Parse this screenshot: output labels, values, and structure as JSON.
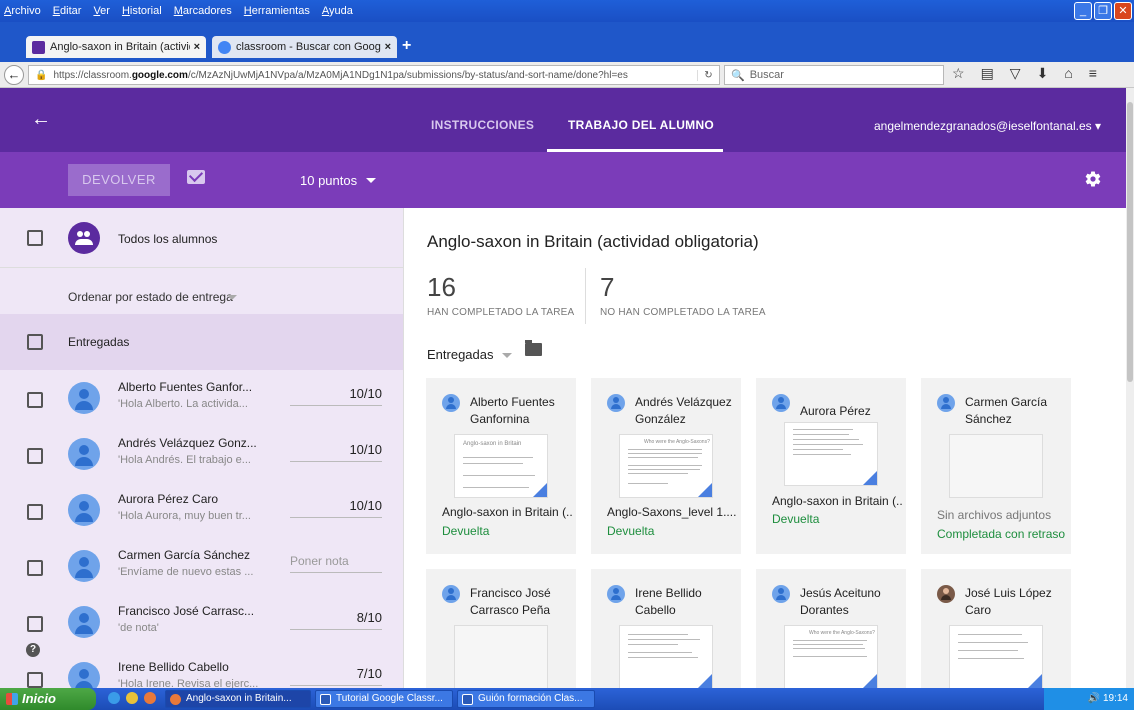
{
  "browser": {
    "menu": [
      "Archivo",
      "Editar",
      "Ver",
      "Historial",
      "Marcadores",
      "Herramientas",
      "Ayuda"
    ],
    "tabs": [
      {
        "title": "Anglo-saxon in Britain (activid...",
        "close": "×",
        "color": "#5b2b9f"
      },
      {
        "title": "classroom - Buscar con Google",
        "close": "×",
        "color": "#4285f4"
      }
    ],
    "new_tab": "+",
    "url_prefix": "https://classroom.",
    "url_domain": "google.com",
    "url_suffix": "/c/MzAzNjUwMjA1NVpa/a/MzA0MjA1NDg1N1pa/submissions/by-status/and-sort-name/done?hl=es",
    "search_placeholder": "Buscar"
  },
  "app_header": {
    "tab_instructions": "INSTRUCCIONES",
    "tab_student_work": "TRABAJO DEL ALUMNO",
    "user_email": "angelmendezgranados@ieselfontanal.es"
  },
  "toolbar": {
    "return_label": "DEVOLVER",
    "points_label": "10 puntos"
  },
  "left_panel": {
    "all_students_label": "Todos los alumnos",
    "sort_label": "Ordenar por estado de entrega",
    "group_label": "Entregadas",
    "students": [
      {
        "name": "Alberto Fuentes Ganfor...",
        "preview": "'Hola Alberto. La activida...",
        "grade": "10/10"
      },
      {
        "name": "Andrés Velázquez Gonz...",
        "preview": "'Hola Andrés. El trabajo e...",
        "grade": "10/10"
      },
      {
        "name": "Aurora Pérez Caro",
        "preview": "'Hola Aurora, muy buen tr...",
        "grade": "10/10"
      },
      {
        "name": "Carmen García Sánchez",
        "preview": "'Envíame de nuevo estas ...",
        "grade": "Poner nota"
      },
      {
        "name": "Francisco José Carrasc...",
        "preview": "'de nota'",
        "grade": "8/10"
      },
      {
        "name": "Irene Bellido Cabello",
        "preview": "'Hola Irene. Revisa el ejerc...",
        "grade": "7/10"
      }
    ]
  },
  "content": {
    "title": "Anglo-saxon in Britain (actividad obligatoria)",
    "completed_count": "16",
    "completed_label": "HAN COMPLETADO LA TAREA",
    "not_completed_count": "7",
    "not_completed_label": "NO HAN COMPLETADO LA TAREA",
    "filter_label": "Entregadas",
    "cards": [
      {
        "name": "Alberto Fuentes Ganfornina",
        "file": "Anglo-saxon in Britain (...",
        "status": "Devuelta",
        "thumb_title": "Anglo-saxon in Britain"
      },
      {
        "name": "Andrés Velázquez González",
        "file": "Anglo-Saxons_level 1....",
        "status": "Devuelta",
        "thumb_title": "Who were the Anglo-Saxons?"
      },
      {
        "name": "Aurora Pérez Caro",
        "file": "Anglo-saxon in Britain (...",
        "status": "Devuelta",
        "thumb_title": ""
      },
      {
        "name": "Carmen García Sánchez",
        "file": "Sin archivos adjuntos",
        "status": "Completada con retraso",
        "thumb_title": ""
      },
      {
        "name": "Francisco José Carrasco Peña",
        "file": "",
        "status": "",
        "thumb_title": ""
      },
      {
        "name": "Irene Bellido Cabello",
        "file": "",
        "status": "",
        "thumb_title": ""
      },
      {
        "name": "Jesús Aceituno Dorantes",
        "file": "",
        "status": "",
        "thumb_title": "Who were the Anglo-Saxons?"
      },
      {
        "name": "José Luis López Caro",
        "file": "",
        "status": "",
        "thumb_title": ""
      }
    ]
  },
  "taskbar": {
    "start_label": "Inicio",
    "tasks": [
      "Anglo-saxon in Britain...",
      "Tutorial Google Classr...",
      "Guión formación Clas..."
    ],
    "clock": "19:14"
  },
  "colors": {
    "header_purple": "#5b2b9f",
    "toolbar_purple": "#7b3cb9",
    "status_green": "#1e8e3e"
  }
}
